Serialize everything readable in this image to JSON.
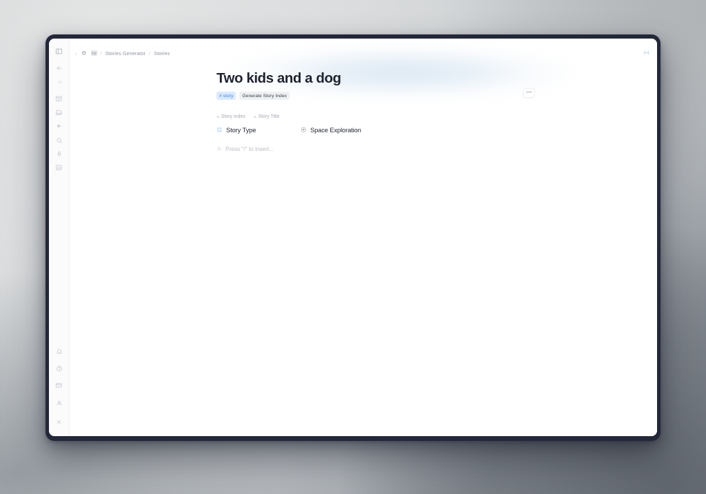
{
  "window": {
    "accent_blue": "#3b82f6",
    "chip_blue_bg": "#dbeafe",
    "bezel_color": "#23273a"
  },
  "topbar": {
    "back_arrow": "‹",
    "globe_icon_name": "globe-icon",
    "workspace_badge": "TW",
    "separator": "/",
    "breadcrumbs": [
      {
        "label": "Stories Generator"
      },
      {
        "label": "Stories"
      }
    ],
    "collapse_icon_name": "collapse-panel-icon"
  },
  "sidebar": {
    "top_items": [
      {
        "name": "toggle-sidebar",
        "icon": "sidebar-panel-icon"
      },
      {
        "name": "back",
        "icon": "arrow-left-icon"
      },
      {
        "name": "forward",
        "icon": "arrow-right-icon"
      },
      {
        "name": "workspace",
        "icon": "layout-table-icon"
      },
      {
        "name": "inbox",
        "icon": "inbox-icon"
      },
      {
        "name": "ai-assistant",
        "icon": "sparkle-icon"
      },
      {
        "name": "search",
        "icon": "search-icon"
      },
      {
        "name": "pinned",
        "icon": "pin-icon"
      },
      {
        "name": "analytics",
        "icon": "chart-bar-icon"
      }
    ],
    "bottom_items": [
      {
        "name": "notifications",
        "icon": "bell-icon"
      },
      {
        "name": "help",
        "icon": "question-circle-icon"
      },
      {
        "name": "billing",
        "icon": "credit-card-icon"
      },
      {
        "name": "account",
        "icon": "user-icon"
      },
      {
        "name": "close",
        "icon": "close-x-icon"
      }
    ]
  },
  "document": {
    "title": "Two kids and a dog",
    "chips": [
      {
        "label": "# story",
        "style": "blue"
      },
      {
        "label": "Generate Story Index",
        "style": "grey"
      }
    ],
    "more_button_label": "•••",
    "add_properties": [
      {
        "plus": "+",
        "label": "Story Index"
      },
      {
        "plus": "+",
        "label": "Story Title"
      }
    ],
    "properties": [
      {
        "key_icon": "select-square-icon",
        "key": "Story Type",
        "value_icon": "radio-dot-icon",
        "value": "Space Exploration"
      }
    ],
    "insert_placeholder": "Press \"/\" to insert...",
    "insert_bullet_icon": "circle-small-icon"
  }
}
